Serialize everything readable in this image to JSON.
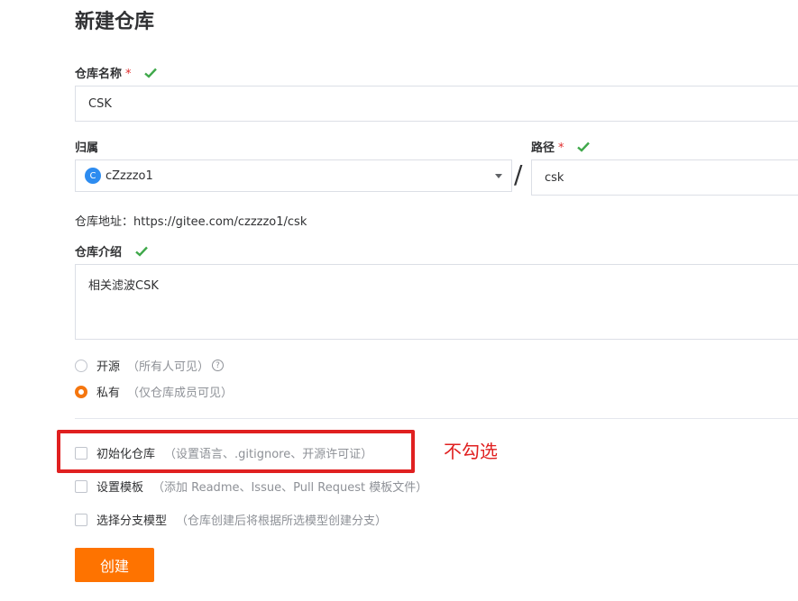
{
  "page": {
    "title": "新建仓库"
  },
  "repo_name": {
    "label": "仓库名称",
    "required_mark": "*",
    "value": "CSK"
  },
  "owner": {
    "label": "归属",
    "avatar_letter": "C",
    "value": "cZzzzo1"
  },
  "separator": "/",
  "path": {
    "label": "路径",
    "required_mark": "*",
    "value": "csk"
  },
  "repo_address": {
    "label": "仓库地址：",
    "value": "https://gitee.com/czzzzo1/csk"
  },
  "description": {
    "label": "仓库介绍",
    "value": "相关滤波CSK"
  },
  "visibility": {
    "options": [
      {
        "label": "开源",
        "hint": "（所有人可见）",
        "help": "?",
        "selected": false
      },
      {
        "label": "私有",
        "hint": "（仅仓库成员可见）",
        "selected": true
      }
    ]
  },
  "options": [
    {
      "label": "初始化仓库",
      "hint": "（设置语言、.gitignore、开源许可证）",
      "checked": false
    },
    {
      "label": "设置模板",
      "hint": "（添加 Readme、Issue、Pull Request 模板文件）",
      "checked": false
    },
    {
      "label": "选择分支模型",
      "hint": "（仓库创建后将根据所选模型创建分支）",
      "checked": false
    }
  ],
  "annotation": {
    "text": "不勾选",
    "color": "#e02020"
  },
  "create_button": {
    "label": "创建",
    "color": "#fe7300"
  },
  "colors": {
    "success_check": "#3fa84a",
    "accent": "#f5760f"
  }
}
